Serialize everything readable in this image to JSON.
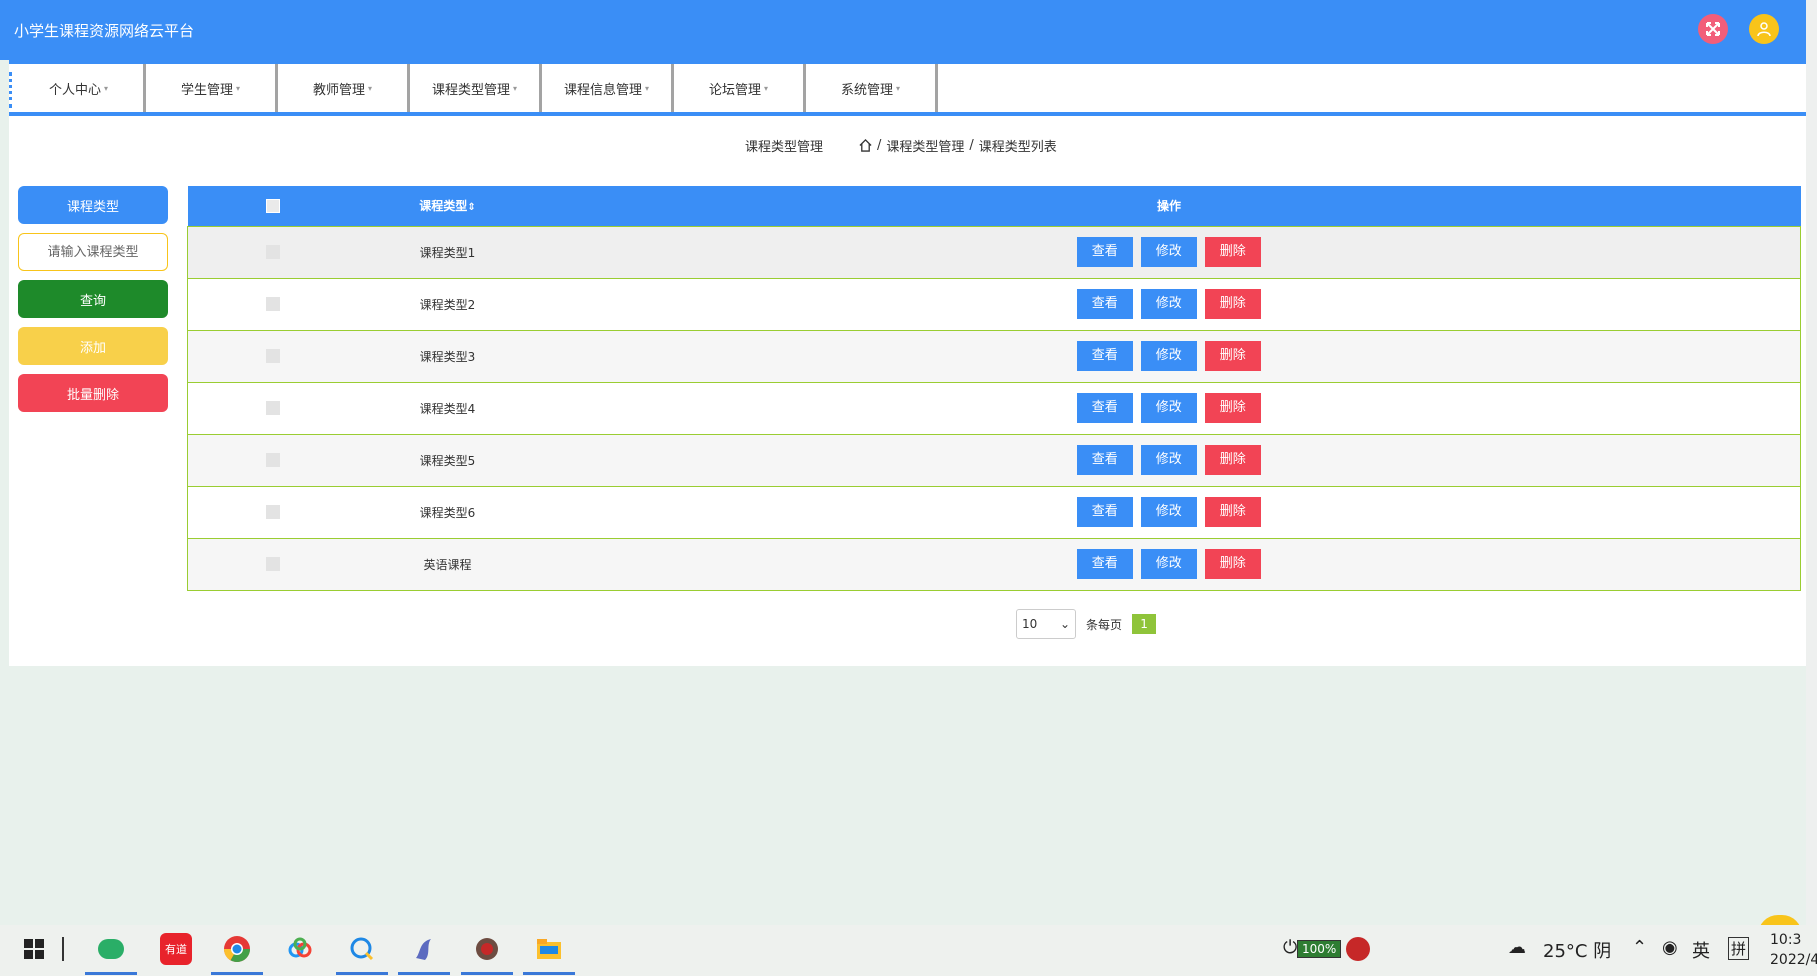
{
  "app": {
    "title": "小学生课程资源网络云平台"
  },
  "header": {
    "fullscreen_icon": "fullscreen-icon",
    "user_icon": "user-icon",
    "colors": {
      "bar": "#3a8ef6",
      "fullscreen": "#f25e7a",
      "user": "#f8c41a"
    }
  },
  "nav": {
    "items": [
      {
        "label": "个人中心"
      },
      {
        "label": "学生管理"
      },
      {
        "label": "教师管理"
      },
      {
        "label": "课程类型管理"
      },
      {
        "label": "课程信息管理"
      },
      {
        "label": "论坛管理"
      },
      {
        "label": "系统管理"
      }
    ]
  },
  "breadcrumb": {
    "title": "课程类型管理",
    "path": [
      "课程类型管理",
      "课程类型列表"
    ],
    "separator": "/"
  },
  "side": {
    "label": "课程类型",
    "search_placeholder": "请输入课程类型",
    "query_label": "查询",
    "add_label": "添加",
    "batch_delete_label": "批量删除"
  },
  "table": {
    "columns": [
      "课程类型",
      "操作"
    ],
    "rows": [
      {
        "name": "课程类型1"
      },
      {
        "name": "课程类型2"
      },
      {
        "name": "课程类型3"
      },
      {
        "name": "课程类型4"
      },
      {
        "name": "课程类型5"
      },
      {
        "name": "课程类型6"
      },
      {
        "name": "英语课程"
      }
    ],
    "actions": {
      "view": "查看",
      "edit": "修改",
      "delete": "删除"
    }
  },
  "pager": {
    "page_size": "10",
    "per_page_label": "条每页",
    "current_page": "1"
  },
  "taskbar": {
    "battery": "100%",
    "weather": "25°C 阴",
    "ime1": "英",
    "ime2": "拼",
    "time": "10:3",
    "date": "2022/4"
  }
}
